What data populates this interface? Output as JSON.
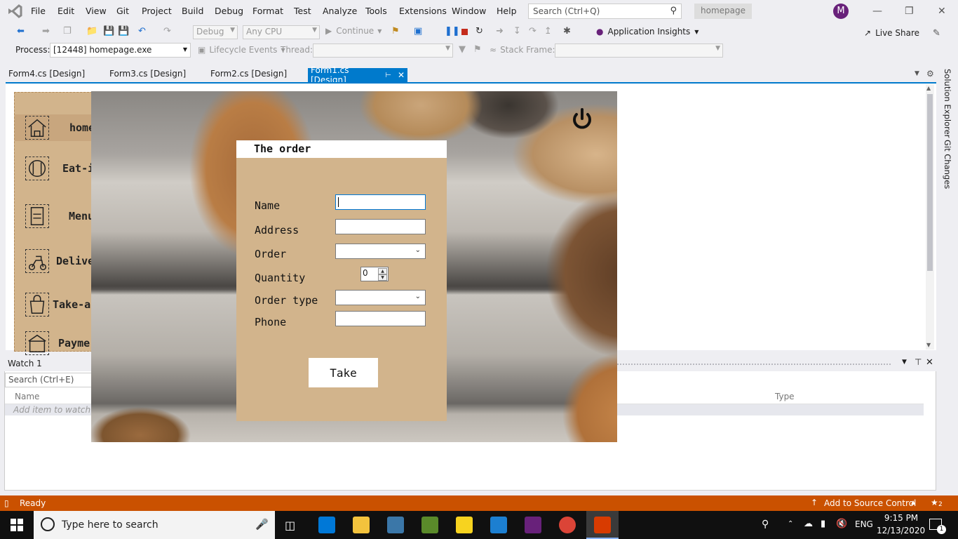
{
  "menubar": {
    "items": [
      "File",
      "Edit",
      "View",
      "Git",
      "Project",
      "Build",
      "Debug",
      "Format",
      "Test",
      "Analyze",
      "Tools",
      "Extensions",
      "Window",
      "Help"
    ],
    "search_placeholder": "Search (Ctrl+Q)",
    "solution_name": "homepage",
    "avatar_initial": "M"
  },
  "toolbar": {
    "config": "Debug",
    "platform": "Any CPU",
    "continue_label": "Continue",
    "app_insights": "Application Insights",
    "live_share": "Live Share"
  },
  "debugbar": {
    "process_label": "Process:",
    "process_value": "[12448] homepage.exe",
    "lifecycle_label": "Lifecycle Events",
    "thread_label": "Thread:",
    "stackframe_label": "Stack Frame:"
  },
  "doc_tabs": [
    "Form4.cs [Design]",
    "Form3.cs [Design]",
    "Form2.cs [Design]"
  ],
  "active_tab": "Form1.cs [Design]",
  "side_panels": [
    "Solution Explorer",
    "Git Changes"
  ],
  "form1_nav": [
    {
      "label": "home",
      "icon": "house-icon"
    },
    {
      "label": "Eat-i",
      "icon": "restaurant-icon"
    },
    {
      "label": "Menu",
      "icon": "menu-board-icon"
    },
    {
      "label": "Delive",
      "icon": "scooter-delivery-icon"
    },
    {
      "label": "Take-a",
      "icon": "takeaway-bag-icon"
    },
    {
      "label": "Payme",
      "icon": "payment-icon"
    }
  ],
  "order_form": {
    "title": "The order",
    "fields": {
      "name": "Name",
      "address": "Address",
      "order": "Order",
      "quantity": "Quantity",
      "order_type": "Order type",
      "phone": "Phone"
    },
    "quantity_value": "0",
    "submit_label": "Take"
  },
  "watch": {
    "title": "Watch 1",
    "search_placeholder": "Search (Ctrl+E)",
    "col_name": "Name",
    "col_type": "Type",
    "add_item": "Add item to watch"
  },
  "statusbar": {
    "status": "Ready",
    "source_control": "Add to Source Control",
    "notifications": "2"
  },
  "taskbar": {
    "search_placeholder": "Type here to search",
    "lang": "ENG",
    "time": "9:15 PM",
    "date": "12/13/2020",
    "notification_count": "1"
  },
  "colors": {
    "accent": "#007acc",
    "statusbar": "#ca5100",
    "form_panel": "#d2b48c",
    "vs_purple": "#68217a"
  }
}
